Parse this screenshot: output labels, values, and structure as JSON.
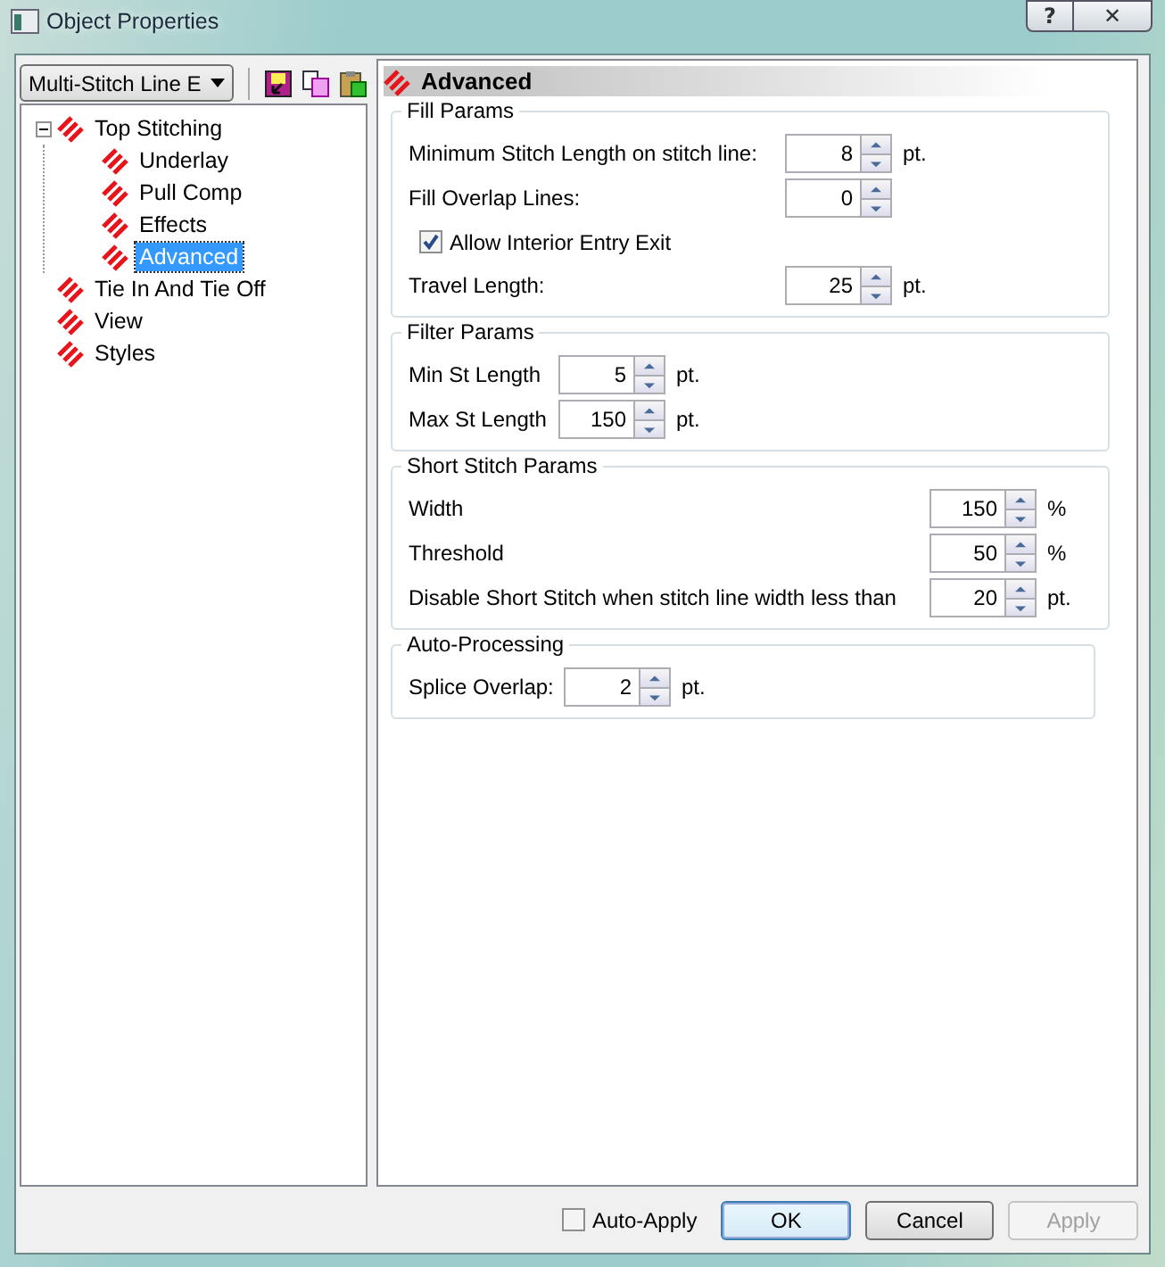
{
  "window": {
    "title": "Object Properties",
    "help": "?",
    "close": "✕"
  },
  "toolbar": {
    "dropdown": "Multi-Stitch Line E"
  },
  "tree": [
    {
      "label": "Top Stitching",
      "selected": false,
      "expanded": true,
      "children": [
        {
          "label": "Underlay",
          "selected": false
        },
        {
          "label": "Pull Comp",
          "selected": false
        },
        {
          "label": "Effects",
          "selected": false
        },
        {
          "label": "Advanced",
          "selected": true
        }
      ]
    },
    {
      "label": "Tie In And Tie Off",
      "selected": false
    },
    {
      "label": "View",
      "selected": false
    },
    {
      "label": "Styles",
      "selected": false
    }
  ],
  "panel": {
    "title": "Advanced",
    "groups": [
      {
        "title": "Fill Params",
        "rows": [
          {
            "kind": "spin",
            "label": "Minimum Stitch Length on stitch line:",
            "value": "8",
            "unit": "pt."
          },
          {
            "kind": "spin",
            "label": "Fill Overlap Lines:",
            "value": "0"
          },
          {
            "kind": "checkbox",
            "label": "Allow Interior Entry Exit",
            "checked": true
          },
          {
            "kind": "spin",
            "label": "Travel Length:",
            "value": "25",
            "unit": "pt."
          }
        ]
      },
      {
        "title": "Filter Params",
        "rows": [
          {
            "kind": "spin",
            "label": "Min St Length",
            "value": "5",
            "unit": "pt."
          },
          {
            "kind": "spin",
            "label": "Max St Length",
            "value": "150",
            "unit": "pt."
          }
        ]
      },
      {
        "title": "Short Stitch Params",
        "rows": [
          {
            "kind": "spin",
            "label": "Width",
            "value": "150",
            "unit": "%"
          },
          {
            "kind": "spin",
            "label": "Threshold",
            "value": "50",
            "unit": "%"
          },
          {
            "kind": "spin",
            "label": "Disable Short Stitch when stitch line width less than",
            "value": "20",
            "unit": "pt."
          }
        ]
      },
      {
        "title": "Auto-Processing",
        "rows": [
          {
            "kind": "spin",
            "label": "Splice Overlap:",
            "value": "2",
            "unit": "pt."
          }
        ]
      }
    ]
  },
  "footer": {
    "auto_apply": {
      "label": "Auto-Apply",
      "checked": false
    },
    "buttons": [
      {
        "label": "OK",
        "default": true,
        "disabled": false
      },
      {
        "label": "Cancel",
        "default": false,
        "disabled": false
      },
      {
        "label": "Apply",
        "default": false,
        "disabled": true
      }
    ]
  }
}
